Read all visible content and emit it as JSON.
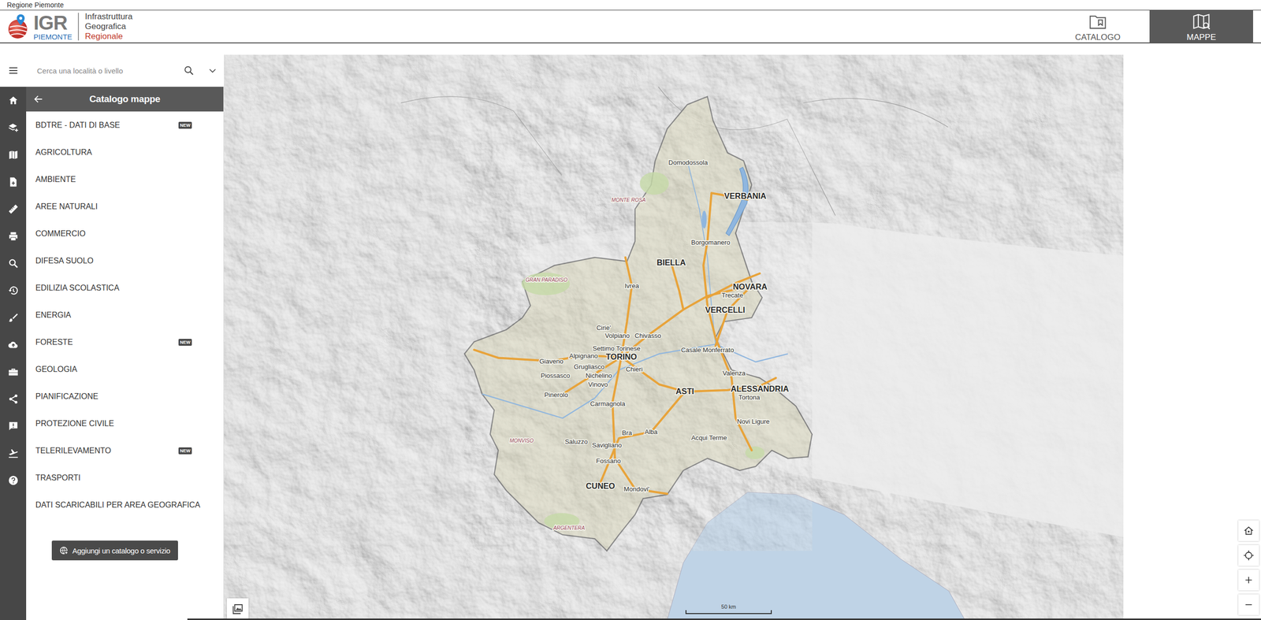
{
  "header": {
    "top_label": "Regione Piemonte",
    "logo": {
      "mark": "IGR",
      "region": "PIEMONTE",
      "line1": "Infrastruttura",
      "line2": "Geografica",
      "line3": "Regionale"
    },
    "nav": [
      {
        "label": "CATALOGO",
        "selected": false
      },
      {
        "label": "MAPPE",
        "selected": true
      }
    ]
  },
  "search": {
    "placeholder": "Cerca una località o livello"
  },
  "panel": {
    "title": "Catalogo mappe",
    "items": [
      {
        "label": "BDTRE - DATI DI BASE",
        "badge": "NEW"
      },
      {
        "label": "AGRICOLTURA"
      },
      {
        "label": "AMBIENTE"
      },
      {
        "label": "AREE NATURALI"
      },
      {
        "label": "COMMERCIO"
      },
      {
        "label": "DIFESA SUOLO"
      },
      {
        "label": "EDILIZIA SCOLASTICA"
      },
      {
        "label": "ENERGIA"
      },
      {
        "label": "FORESTE",
        "badge": "NEW"
      },
      {
        "label": "GEOLOGIA"
      },
      {
        "label": "PIANIFICAZIONE"
      },
      {
        "label": "PROTEZIONE CIVILE"
      },
      {
        "label": "TELERILEVAMENTO",
        "badge": "NEW"
      },
      {
        "label": "TRASPORTI"
      },
      {
        "label": "DATI SCARICABILI PER AREA GEOGRAFICA"
      }
    ],
    "button": "Aggiungi un catalogo o servizio"
  },
  "map": {
    "scale": "50 km",
    "labels": [
      {
        "text": "VERBANIA",
        "kind": "capital"
      },
      {
        "text": "BIELLA",
        "kind": "capital"
      },
      {
        "text": "NOVARA",
        "kind": "capital"
      },
      {
        "text": "VERCELLI",
        "kind": "capital"
      },
      {
        "text": "TORINO",
        "kind": "capital"
      },
      {
        "text": "ASTI",
        "kind": "capital"
      },
      {
        "text": "ALESSANDRIA",
        "kind": "capital"
      },
      {
        "text": "CUNEO",
        "kind": "capital"
      },
      {
        "text": "Domodossola",
        "kind": "town"
      },
      {
        "text": "Borgomanero",
        "kind": "town"
      },
      {
        "text": "Ivrea",
        "kind": "town"
      },
      {
        "text": "Trecate",
        "kind": "town"
      },
      {
        "text": "Cirie'",
        "kind": "town"
      },
      {
        "text": "Volpiano",
        "kind": "town"
      },
      {
        "text": "Chivasso",
        "kind": "town"
      },
      {
        "text": "Settimo Torinese",
        "kind": "town"
      },
      {
        "text": "Casale Monferrato",
        "kind": "town"
      },
      {
        "text": "Giaveno",
        "kind": "town"
      },
      {
        "text": "Alpignano",
        "kind": "town"
      },
      {
        "text": "Grugliasco",
        "kind": "town"
      },
      {
        "text": "Piossasco",
        "kind": "town"
      },
      {
        "text": "Nichelino",
        "kind": "town"
      },
      {
        "text": "Chieri",
        "kind": "town"
      },
      {
        "text": "Valenza",
        "kind": "town"
      },
      {
        "text": "Vinovo",
        "kind": "town"
      },
      {
        "text": "Tortona",
        "kind": "town"
      },
      {
        "text": "Pinerolo",
        "kind": "town"
      },
      {
        "text": "Carmagnola",
        "kind": "town"
      },
      {
        "text": "Novi Ligure",
        "kind": "town"
      },
      {
        "text": "Bra",
        "kind": "town"
      },
      {
        "text": "Alba",
        "kind": "town"
      },
      {
        "text": "Acqui Terme",
        "kind": "town"
      },
      {
        "text": "Saluzzo",
        "kind": "town"
      },
      {
        "text": "Savigliano",
        "kind": "town"
      },
      {
        "text": "Fossano",
        "kind": "town"
      },
      {
        "text": "Mondovi'",
        "kind": "town"
      },
      {
        "text": "MONTE ROSA",
        "kind": "peak"
      },
      {
        "text": "GRAN PARADISO",
        "kind": "peak"
      },
      {
        "text": "MONVISO",
        "kind": "peak"
      },
      {
        "text": "ARGENTERA",
        "kind": "peak"
      }
    ]
  }
}
